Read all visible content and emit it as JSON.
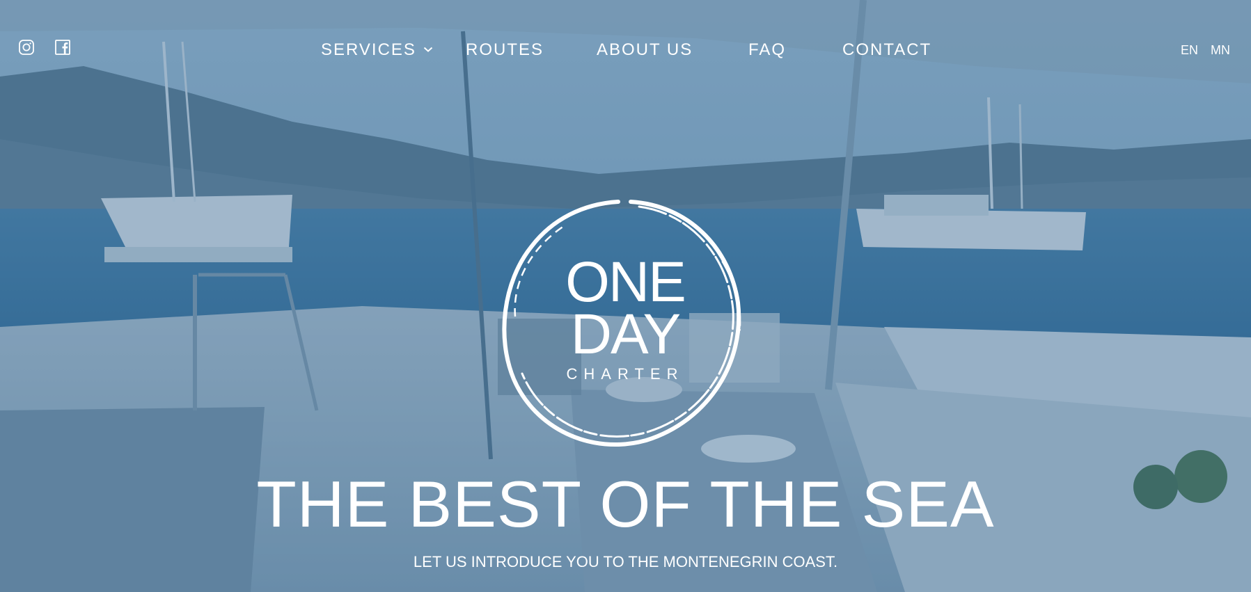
{
  "social": {
    "instagram_icon": "instagram-icon",
    "facebook_icon": "facebook-icon"
  },
  "nav": {
    "items": [
      {
        "label": "SERVICES",
        "has_dropdown": true
      },
      {
        "label": "ROUTES"
      },
      {
        "label": "ABOUT US"
      },
      {
        "label": "FAQ"
      },
      {
        "label": "CONTACT"
      }
    ]
  },
  "lang": {
    "items": [
      {
        "label": "EN"
      },
      {
        "label": "MN"
      }
    ]
  },
  "logo": {
    "line1": "ONE",
    "line2": "DAY",
    "line3": "CHARTER"
  },
  "hero": {
    "headline": "THE BEST OF THE SEA",
    "subline": "LET US INTRODUCE YOU TO THE MONTENEGRIN COAST."
  },
  "colors": {
    "overlay": "#2d5f8c",
    "text": "#ffffff",
    "sky": "#8fb4cf",
    "sea": "#3f7aa3",
    "deck": "#c9d7e0"
  }
}
